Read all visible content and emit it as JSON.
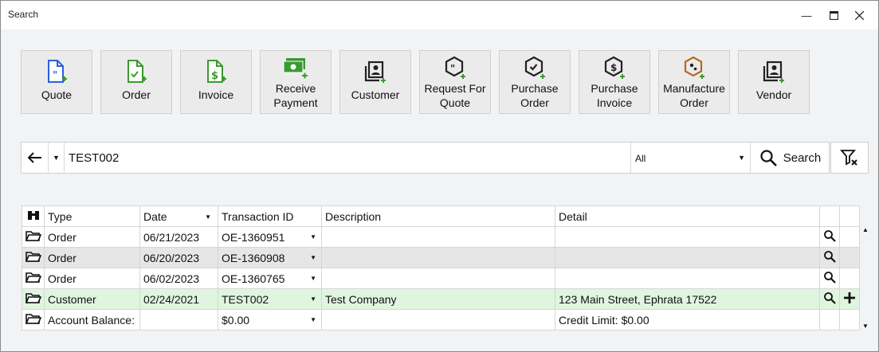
{
  "window": {
    "title": "Search"
  },
  "tiles": [
    {
      "name": "quote",
      "label": "Quote",
      "icon": "quote-add-icon",
      "color": "#2b5fd9"
    },
    {
      "name": "order",
      "label": "Order",
      "icon": "order-add-icon",
      "color": "#3a9a2f"
    },
    {
      "name": "invoice",
      "label": "Invoice",
      "icon": "invoice-add-icon",
      "color": "#3a9a2f"
    },
    {
      "name": "receive-payment",
      "label_line1": "Receive",
      "label_line2": "Payment",
      "icon": "money-add-icon",
      "color": "#3a9a2f"
    },
    {
      "name": "customer",
      "label": "Customer",
      "icon": "contact-add-icon",
      "color": "#222222"
    },
    {
      "name": "request-for-quote",
      "label_line1": "Request For",
      "label_line2": "Quote",
      "icon": "rfq-add-icon",
      "color": "#222222"
    },
    {
      "name": "purchase-order",
      "label_line1": "Purchase",
      "label_line2": "Order",
      "icon": "po-add-icon",
      "color": "#222222"
    },
    {
      "name": "purchase-invoice",
      "label_line1": "Purchase",
      "label_line2": "Invoice",
      "icon": "pinvoice-add-icon",
      "color": "#222222"
    },
    {
      "name": "manufacture-order",
      "label_line1": "Manufacture",
      "label_line2": "Order",
      "icon": "mo-add-icon",
      "color": "#b8691f"
    },
    {
      "name": "vendor",
      "label": "Vendor",
      "icon": "contact-add-icon",
      "color": "#222222"
    }
  ],
  "search": {
    "value": "TEST002",
    "scope": "All",
    "button_label": "Search"
  },
  "grid": {
    "columns": [
      "Type",
      "Date",
      "Transaction ID",
      "Description",
      "Detail"
    ],
    "rows": [
      {
        "type": "Order",
        "date": "06/21/2023",
        "tid": "OE-1360951",
        "description": "",
        "detail": ""
      },
      {
        "type": "Order",
        "date": "06/20/2023",
        "tid": "OE-1360908",
        "description": "",
        "detail": ""
      },
      {
        "type": "Order",
        "date": "06/02/2023",
        "tid": "OE-1360765",
        "description": "",
        "detail": ""
      },
      {
        "type": "Customer",
        "date": "02/24/2021",
        "tid": "TEST002",
        "description": "Test Company",
        "detail": "123 Main Street, Ephrata 17522"
      },
      {
        "type": "Account Balance:",
        "date": "",
        "tid": "$0.00",
        "description": "",
        "detail": "Credit Limit: $0.00"
      }
    ]
  },
  "colors": {
    "accent_green": "#3a9a2f",
    "highlight_row": "#dff5df",
    "selected_row": "#e6e6e6"
  }
}
